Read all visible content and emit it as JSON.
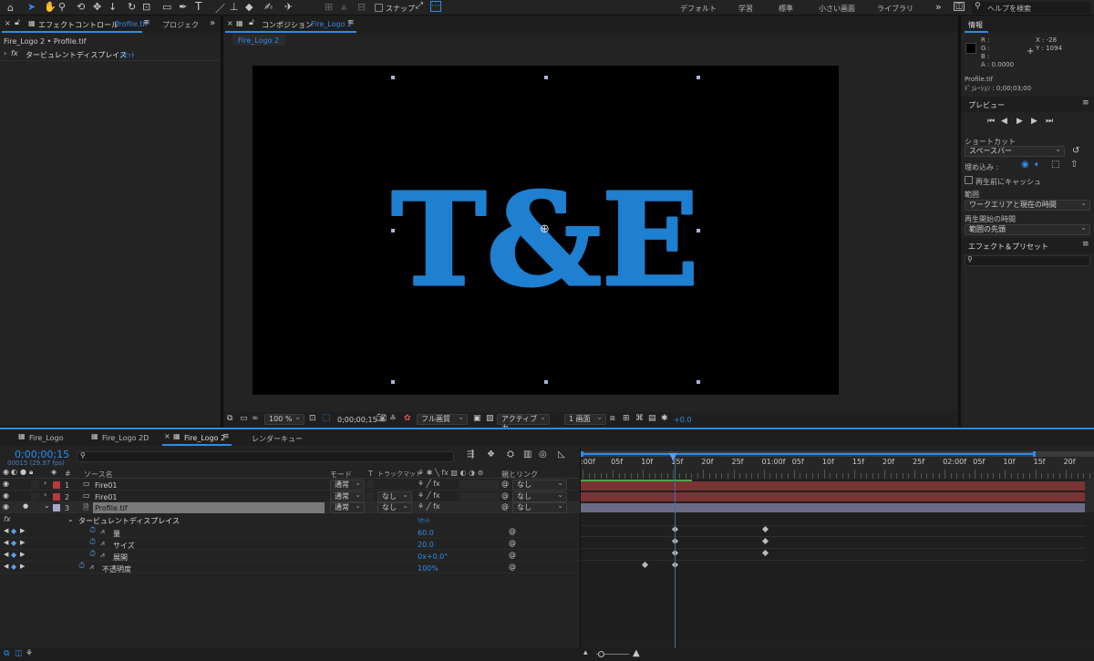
{
  "toolbar": {
    "snap_label": "スナップ",
    "workspaces": [
      "デフォルト",
      "学習",
      "標準",
      "小さい画面",
      "ライブラリ"
    ],
    "help_placeholder": "ヘルプを検索"
  },
  "effect_panel": {
    "tab_label": "エフェクトコントロール",
    "tab_file": "Profile.tif",
    "tab2_label": "プロジェク",
    "breadcrumb": "Fire_Logo 2 • Profile.tif",
    "effect_name": "タービュレントディスプレイス",
    "reset": "ﾘｾｯﾄ"
  },
  "comp_panel": {
    "tab_label": "コンポジション",
    "tab_name": "Fire_Logo 2",
    "subtab": "Fire_Logo 2",
    "logo_text": "T&E",
    "footer": {
      "zoom": "100 %",
      "timecode": "0;00;00;15",
      "quality": "フル画質",
      "camera": "アクティブカ...",
      "views": "1 画面",
      "exposure": "+0.0"
    }
  },
  "info_panel": {
    "title": "情報",
    "r": "R :",
    "g": "G :",
    "b": "B :",
    "a": "A :  0.0000",
    "x": "X : -28",
    "y": "Y : 1094",
    "file": "Profile.tif",
    "duration": "ﾃﾞｭﾚｰｼｮﾝ : 0;00;03;00"
  },
  "preview_panel": {
    "title": "プレビュー",
    "shortcut_label": "ショートカット",
    "shortcut_value": "スペースバー",
    "embed_label": "埋め込み :",
    "cache_label": "再生前にキャッシュ",
    "range_label": "範囲",
    "range_value": "ワークエリアと現在の時間",
    "start_label": "再生開始の時間",
    "start_value": "範囲の先頭"
  },
  "effects_presets": {
    "title": "エフェクト＆プリセット"
  },
  "timeline": {
    "tabs": [
      "Fire_Logo",
      "Fire_Logo 2D",
      "Fire_Logo 2",
      "レンダーキュー"
    ],
    "timecode": "0;00;00;15",
    "fps": "00015 (29.97 fps)",
    "columns": {
      "num": "#",
      "source": "ソース名",
      "mode": "モード",
      "t": "T",
      "trkmat": "トラックマット",
      "parent": "親とリンク"
    },
    "layers": [
      {
        "num": "1",
        "name": "Fire01",
        "mode": "通常",
        "trkmat": "",
        "parent": "なし",
        "color": "#b83a3a"
      },
      {
        "num": "2",
        "name": "Fire01",
        "mode": "通常",
        "trkmat": "なし",
        "parent": "なし",
        "color": "#b83a3a"
      },
      {
        "num": "3",
        "name": "Profile.tif",
        "mode": "通常",
        "trkmat": "なし",
        "parent": "なし",
        "color": "#a8a8c8"
      }
    ],
    "effect_name": "タービュレントディスプレイス",
    "effect_reset": "ﾘｾｯﾄ",
    "properties": [
      {
        "name": "量",
        "value": "60.0"
      },
      {
        "name": "サイズ",
        "value": "20.0"
      },
      {
        "name": "展開",
        "value": "0x+0.0°"
      },
      {
        "name": "不透明度",
        "value": "100%"
      }
    ],
    "ruler": [
      ":00f",
      "05f",
      "10f",
      "15f",
      "20f",
      "25f",
      "01:00f",
      "05f",
      "10f",
      "15f",
      "20f",
      "25f",
      "02:00f",
      "05f",
      "10f",
      "15f",
      "20f"
    ]
  }
}
